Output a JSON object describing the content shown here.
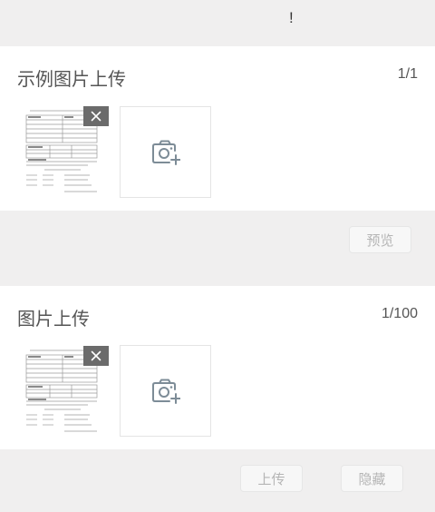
{
  "topbar": {
    "mark": "!"
  },
  "section_example": {
    "title": "示例图片上传",
    "count": "1/1"
  },
  "section_upload": {
    "title": "图片上传",
    "count": "1/100"
  },
  "buttons": {
    "preview": "预览",
    "upload": "上传",
    "hide": "隐藏"
  },
  "icons": {
    "delete": "close-icon",
    "add": "camera-plus-icon"
  },
  "colors": {
    "background": "#f0efef",
    "card": "#ffffff",
    "delete_badge": "#6b6b6b",
    "icon": "#7d8c97",
    "button_text": "#b5b5b5"
  }
}
